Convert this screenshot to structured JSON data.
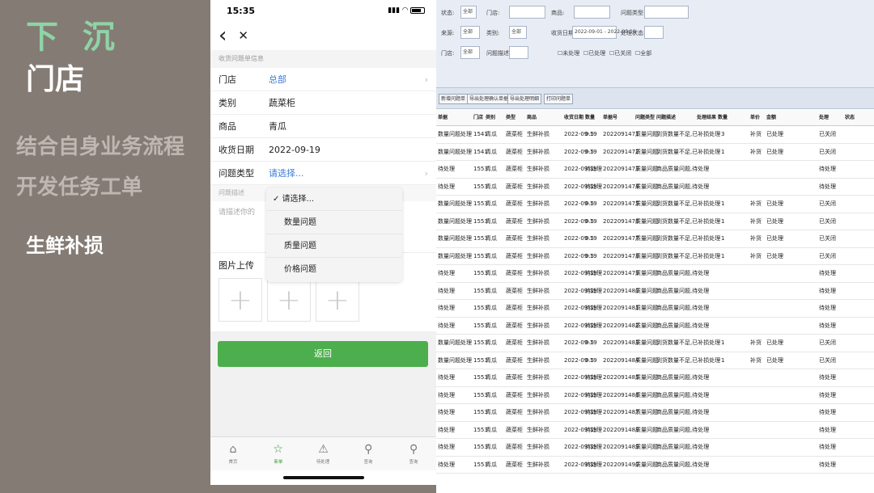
{
  "slide": {
    "title1": "下 沉",
    "title2": "门店",
    "line1": "结合自身业务流程",
    "line2": "开发任务工单",
    "tag": "生鲜补损"
  },
  "phone": {
    "time": "15:35",
    "nav": {
      "back": "‹",
      "close": "✕"
    },
    "section": "收货问题单信息",
    "rows": [
      {
        "label": "门店",
        "value": "总部",
        "link": true
      },
      {
        "label": "类别",
        "value": "蔬菜柜",
        "link": false
      },
      {
        "label": "商品",
        "value": "青瓜",
        "link": false
      },
      {
        "label": "收货日期",
        "value": "2022-09-19",
        "link": false
      },
      {
        "label": "问题类型",
        "value": "请选择...",
        "link": true
      }
    ],
    "desc_label": "问题描述",
    "desc_placeholder": "请描述你的",
    "image_label": "图片上传",
    "plus": "+",
    "submit": "返回",
    "dropdown": [
      "✓ 请选择...",
      "数量问题",
      "质量问题",
      "价格问题"
    ],
    "tabs": [
      {
        "label": "首页",
        "icon": "⌂"
      },
      {
        "label": "新单",
        "icon": "☆"
      },
      {
        "label": "待处理",
        "icon": "⚠"
      },
      {
        "label": "查询",
        "icon": "⚲"
      },
      {
        "label": "查询",
        "icon": "⚲"
      }
    ]
  },
  "erp": {
    "filters": {
      "row1": [
        {
          "l": "状态:",
          "v": "全部"
        },
        {
          "l": "门店:",
          "v": ""
        },
        {
          "l": "商品:",
          "v": ""
        },
        {
          "l": "问题类型:",
          "v": ""
        }
      ],
      "row2": [
        {
          "l": "来源:",
          "v": "全部"
        },
        {
          "l": "类别:",
          "v": "全部"
        },
        {
          "l": "收货日期:",
          "v": "2022-09-01 - 2022-09-19"
        },
        {
          "l": "处理状态:",
          "v": ""
        }
      ],
      "row3": [
        {
          "l": "门店:",
          "v": "全部"
        },
        {
          "l": "问题描述:",
          "v": ""
        }
      ],
      "checks": [
        "未处理",
        "已处理",
        "已关闭",
        "全部"
      ]
    },
    "toolbar": [
      "新增问题单",
      "导出处理确认单据",
      "导出处理明细",
      "打印问题单"
    ],
    "headers": [
      "单据",
      "门店",
      "类别",
      "类型",
      "商品",
      "收货日期",
      "数量",
      "单据号",
      "问题类型",
      "问题描述",
      "处理结果",
      "数量",
      "单价",
      "金额",
      "处理",
      "状态"
    ],
    "rows": [
      [
        "数量问题处理",
        "1541",
        "青瓜",
        "蔬菜柜",
        "生鲜补损",
        "2022-09-19",
        "0.5",
        "2022091471",
        "质量问题",
        "到货数量不足,已补损处理",
        "3",
        "补货",
        "已处理",
        "已关闭"
      ],
      [
        "数量问题处理",
        "1541",
        "青瓜",
        "蔬菜柜",
        "生鲜补损",
        "2022-09-19",
        "0.5",
        "2022091472",
        "质量问题",
        "到货数量不足,已补损处理",
        "1",
        "补货",
        "已处理",
        "已关闭"
      ],
      [
        "待处理",
        "1553",
        "青瓜",
        "蔬菜柜",
        "生鲜补损",
        "2022-09-19",
        "待处理",
        "2022091473",
        "质量问题",
        "商品质量问题,待处理",
        "",
        "",
        "",
        "待处理"
      ],
      [
        "待处理",
        "1553",
        "青瓜",
        "蔬菜柜",
        "生鲜补损",
        "2022-09-19",
        "待处理",
        "2022091474",
        "质量问题",
        "商品质量问题,待处理",
        "",
        "",
        "",
        "待处理"
      ],
      [
        "数量问题处理",
        "1553",
        "青瓜",
        "蔬菜柜",
        "生鲜补损",
        "2022-09-19",
        "0.5",
        "2022091475",
        "质量问题",
        "到货数量不足,已补损处理",
        "1",
        "补货",
        "已处理",
        "已关闭"
      ],
      [
        "数量问题处理",
        "1553",
        "青瓜",
        "蔬菜柜",
        "生鲜补损",
        "2022-09-19",
        "0.5",
        "2022091476",
        "质量问题",
        "到货数量不足,已补损处理",
        "1",
        "补货",
        "已处理",
        "已关闭"
      ],
      [
        "数量问题处理",
        "1553",
        "青瓜",
        "蔬菜柜",
        "生鲜补损",
        "2022-09-19",
        "0.5",
        "2022091477",
        "质量问题",
        "到货数量不足,已补损处理",
        "1",
        "补货",
        "已处理",
        "已关闭"
      ],
      [
        "数量问题处理",
        "1553",
        "青瓜",
        "蔬菜柜",
        "生鲜补损",
        "2022-09-19",
        "0.5",
        "2022091478",
        "质量问题",
        "到货数量不足,已补损处理",
        "1",
        "补货",
        "已处理",
        "已关闭"
      ],
      [
        "待处理",
        "1553",
        "青瓜",
        "蔬菜柜",
        "生鲜补损",
        "2022-09-19",
        "待处理",
        "2022091479",
        "质量问题",
        "商品质量问题,待处理",
        "",
        "",
        "",
        "待处理"
      ],
      [
        "待处理",
        "1553",
        "青瓜",
        "蔬菜柜",
        "生鲜补损",
        "2022-09-19",
        "待处理",
        "2022091480",
        "质量问题",
        "商品质量问题,待处理",
        "",
        "",
        "",
        "待处理"
      ],
      [
        "待处理",
        "1553",
        "青瓜",
        "蔬菜柜",
        "生鲜补损",
        "2022-09-19",
        "待处理",
        "2022091481",
        "质量问题",
        "商品质量问题,待处理",
        "",
        "",
        "",
        "待处理"
      ],
      [
        "待处理",
        "1553",
        "青瓜",
        "蔬菜柜",
        "生鲜补损",
        "2022-09-19",
        "待处理",
        "2022091482",
        "质量问题",
        "商品质量问题,待处理",
        "",
        "",
        "",
        "待处理"
      ],
      [
        "数量问题处理",
        "1553",
        "青瓜",
        "蔬菜柜",
        "生鲜补损",
        "2022-09-19",
        "0.5",
        "2022091483",
        "质量问题",
        "到货数量不足,已补损处理",
        "1",
        "补货",
        "已处理",
        "已关闭"
      ],
      [
        "数量问题处理",
        "1553",
        "青瓜",
        "蔬菜柜",
        "生鲜补损",
        "2022-09-19",
        "0.5",
        "2022091484",
        "质量问题",
        "到货数量不足,已补损处理",
        "1",
        "补货",
        "已处理",
        "已关闭"
      ],
      [
        "待处理",
        "1553",
        "青瓜",
        "蔬菜柜",
        "生鲜补损",
        "2022-09-19",
        "待处理",
        "2022091485",
        "质量问题",
        "商品质量问题,待处理",
        "",
        "",
        "",
        "待处理"
      ],
      [
        "待处理",
        "1553",
        "青瓜",
        "蔬菜柜",
        "生鲜补损",
        "2022-09-19",
        "待处理",
        "2022091486",
        "质量问题",
        "商品质量问题,待处理",
        "",
        "",
        "",
        "待处理"
      ],
      [
        "待处理",
        "1553",
        "青瓜",
        "蔬菜柜",
        "生鲜补损",
        "2022-09-19",
        "待处理",
        "2022091487",
        "质量问题",
        "商品质量问题,待处理",
        "",
        "",
        "",
        "待处理"
      ],
      [
        "待处理",
        "1553",
        "青瓜",
        "蔬菜柜",
        "生鲜补损",
        "2022-09-19",
        "待处理",
        "2022091488",
        "质量问题",
        "商品质量问题,待处理",
        "",
        "",
        "",
        "待处理"
      ],
      [
        "待处理",
        "1553",
        "青瓜",
        "蔬菜柜",
        "生鲜补损",
        "2022-09-19",
        "待处理",
        "2022091489",
        "质量问题",
        "商品质量问题,待处理",
        "",
        "",
        "",
        "待处理"
      ],
      [
        "待处理",
        "1553",
        "青瓜",
        "蔬菜柜",
        "生鲜补损",
        "2022-09-19",
        "待处理",
        "2022091490",
        "质量问题",
        "商品质量问题,待处理",
        "",
        "",
        "",
        "待处理"
      ]
    ]
  }
}
